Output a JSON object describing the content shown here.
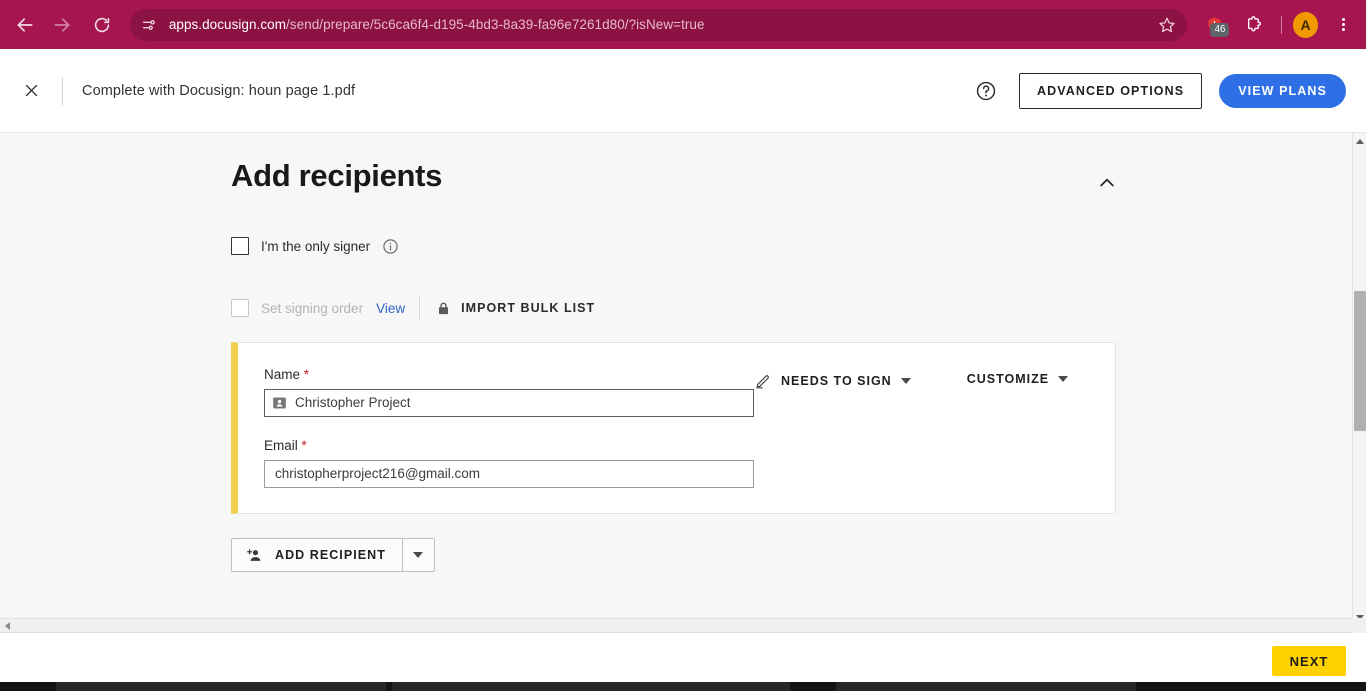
{
  "browser": {
    "url_host": "apps.docusign.com",
    "url_path": "/send/prepare/5c6ca6f4-d195-4bd3-8a39-fa96e7261d80/?isNew=true",
    "back_icon": "back-arrow-icon",
    "forward_icon": "forward-arrow-icon",
    "reload_icon": "reload-icon",
    "site_info_icon": "site-settings-icon",
    "bookmark_icon": "star-icon",
    "extension_badge_count": "46",
    "profile_initial": "A",
    "menu_icon": "three-dot-menu-icon",
    "toolbar_color": "#a6154f",
    "omnibox_color": "#8c1243"
  },
  "header": {
    "close_label": "×",
    "title": "Complete with Docusign: houn page 1.pdf",
    "help_label": "?",
    "advanced_options_label": "ADVANCED OPTIONS",
    "view_plans_label": "VIEW PLANS",
    "view_plans_color": "#2e6fe5"
  },
  "main": {
    "page_title": "Add recipients",
    "collapse_icon": "chevron-up-icon",
    "only_signer": {
      "label": "I'm the only signer",
      "checked": false,
      "info_icon": "info-icon"
    },
    "signing_order": {
      "label": "Set signing order",
      "checked": false,
      "disabled": true,
      "view_link": "View",
      "lock_icon": "lock-icon",
      "bulk_list_label": "IMPORT BULK LIST"
    },
    "recipient": {
      "accent_color": "#f5d04e",
      "name_label": "Name",
      "name_required": "*",
      "name_value": "Christopher Project",
      "name_icon": "contact-card-icon",
      "email_label": "Email",
      "email_required": "*",
      "email_value": "christopherproject216@gmail.com",
      "role_icon": "pen-icon",
      "role_label": "NEEDS TO SIGN",
      "customize_label": "CUSTOMIZE"
    },
    "add_recipient": {
      "label": "ADD RECIPIENT",
      "icon": "person-add-icon",
      "dropdown_icon": "caret-down-icon"
    }
  },
  "footer": {
    "next_label": "NEXT",
    "next_color": "#ffd100"
  }
}
